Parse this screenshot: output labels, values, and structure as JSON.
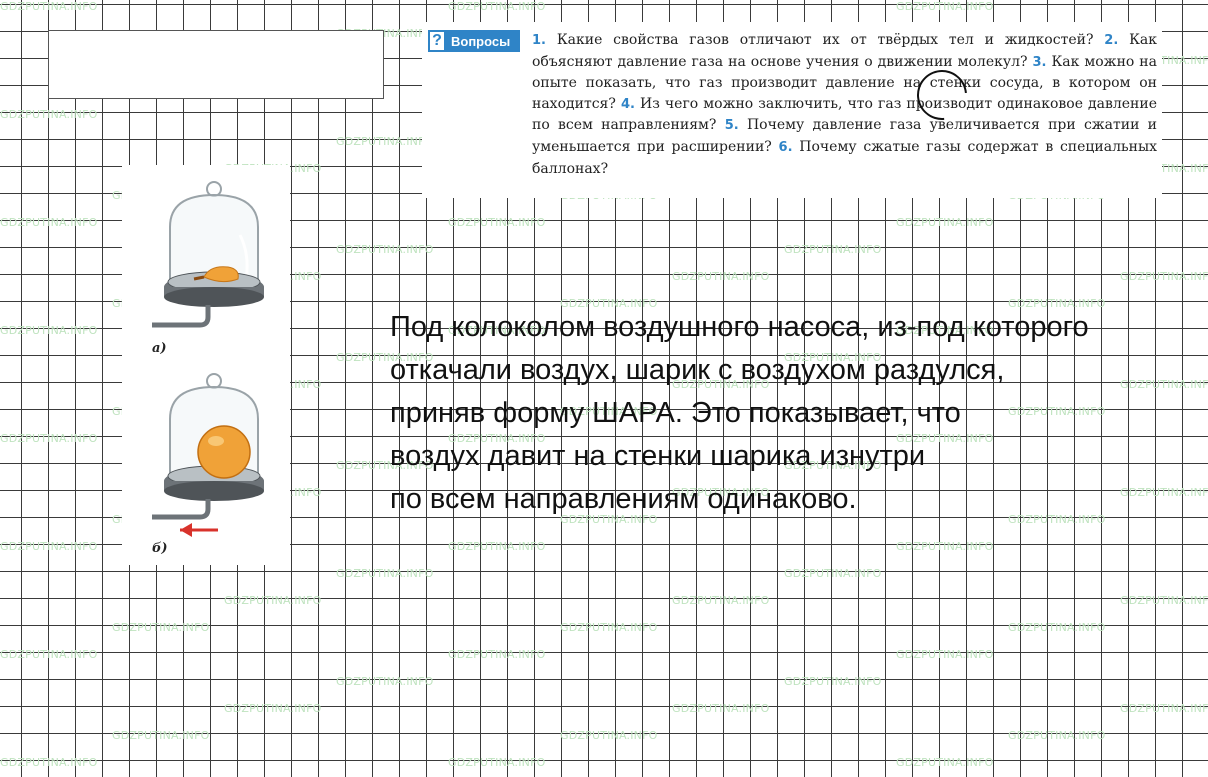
{
  "watermark_text": "GDZPUTINA.INFO",
  "questions": {
    "badge_label": "Вопросы",
    "items": [
      {
        "num": "1.",
        "text": "Какие свойства газов отличают их от твёрдых тел и жидкостей?"
      },
      {
        "num": "2.",
        "text": "Как объясняют давление газа на основе учения о движении молекул?"
      },
      {
        "num": "3.",
        "text": "Как можно на опыте показать, что газ производит давление на стенки сосуда, в котором он находится?"
      },
      {
        "num": "4.",
        "text": "Из чего можно заключить, что газ производит одинаковое давление по всем направлениям?"
      },
      {
        "num": "5.",
        "text": "Почему давление газа увеличивается при сжатии и уменьшается при расширении?"
      },
      {
        "num": "6.",
        "text": "Почему сжатые газы содержат в специальных баллонах?"
      }
    ]
  },
  "figure": {
    "caption_a": "а)",
    "caption_b": "б)",
    "colors": {
      "balloon": "#f0a238",
      "glass": "#9aa3a8",
      "plate": "#6d7378",
      "arrow": "#d8322b"
    }
  },
  "answer": {
    "lines": [
      "Под колоколом воздушного насоса, из-под которого",
      "откачали воздух, шарик с воздухом раздулся,",
      "приняв форму ШАРА. Это показывает, что",
      "воздух давит на стенки шарика изнутри",
      "по всем направлениям одинаково."
    ]
  }
}
